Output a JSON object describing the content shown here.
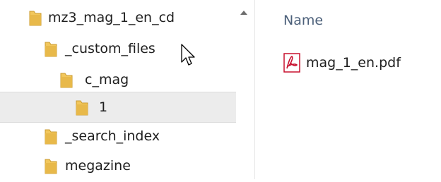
{
  "window": {
    "active_item": "_custom_files"
  },
  "tree": {
    "items": [
      {
        "label": "mz3_mag_1_en_cd",
        "selected": false,
        "icon": "folder-icon"
      },
      {
        "label": "_custom_files",
        "selected": false,
        "icon": "folder-icon"
      },
      {
        "label": "c_mag",
        "selected": false,
        "icon": "folder-icon"
      },
      {
        "label": "1",
        "selected": true,
        "icon": "folder-icon"
      },
      {
        "label": "_search_index",
        "selected": false,
        "icon": "folder-icon"
      },
      {
        "label": "megazine",
        "selected": false,
        "icon": "folder-icon"
      }
    ]
  },
  "content": {
    "column_header": "Name",
    "files": [
      {
        "name": "mag_1_en.pdf",
        "icon": "pdf-icon"
      }
    ]
  },
  "colors": {
    "folder": "#e8b94a",
    "selection": "#ececec",
    "header_text": "#4c607a",
    "pdf_red": "#c8102e"
  }
}
